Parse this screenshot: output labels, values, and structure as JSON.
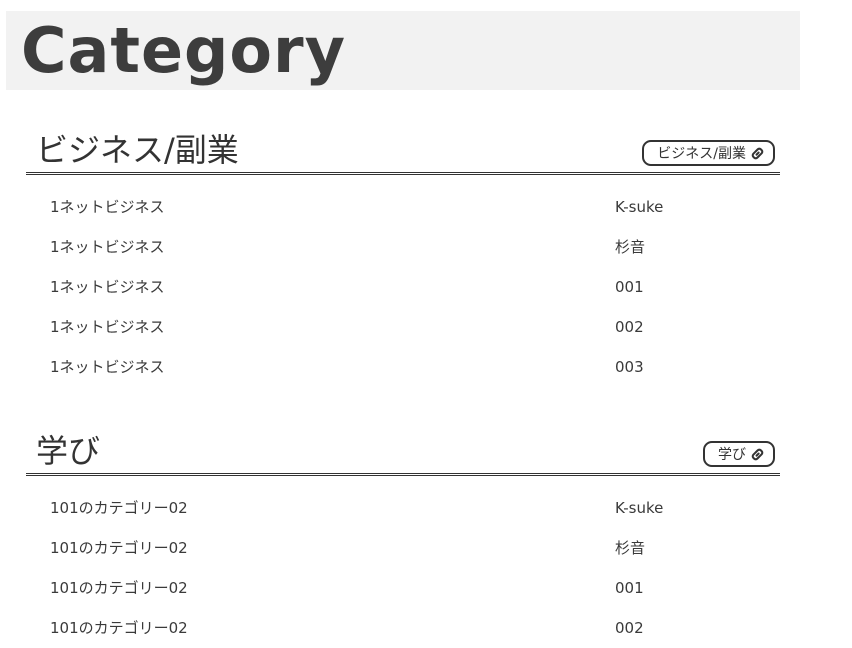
{
  "page": {
    "title": "Category"
  },
  "sections": [
    {
      "title": "ビジネス/副業",
      "link_label": "ビジネス/副業",
      "posts": [
        {
          "title": "1ネットビジネス",
          "author": "K-suke"
        },
        {
          "title": "1ネットビジネス",
          "author": "杉音"
        },
        {
          "title": "1ネットビジネス",
          "author": "001"
        },
        {
          "title": "1ネットビジネス",
          "author": "002"
        },
        {
          "title": "1ネットビジネス",
          "author": "003"
        }
      ]
    },
    {
      "title": "学び",
      "link_label": "学び",
      "posts": [
        {
          "title": "101のカテゴリー02",
          "author": "K-suke"
        },
        {
          "title": "101のカテゴリー02",
          "author": "杉音"
        },
        {
          "title": "101のカテゴリー02",
          "author": "001"
        },
        {
          "title": "101のカテゴリー02",
          "author": "002"
        }
      ]
    }
  ],
  "icons": {
    "link": "link-icon"
  },
  "colors": {
    "header_bg": "#f2f2f2",
    "text": "#333333"
  }
}
